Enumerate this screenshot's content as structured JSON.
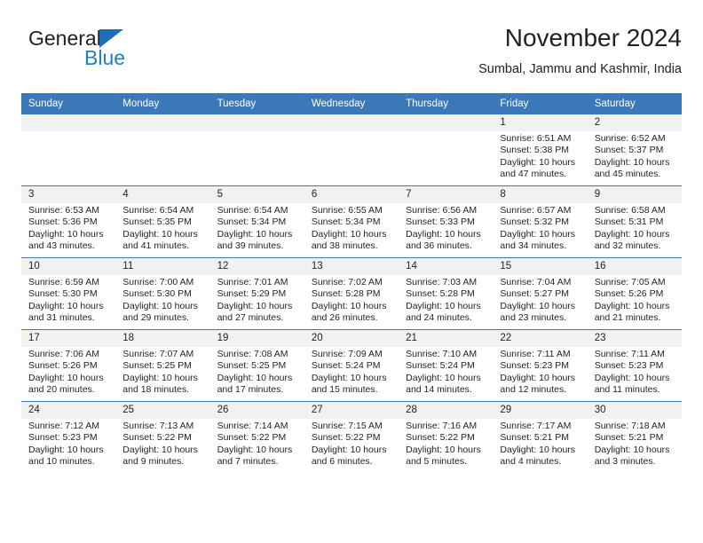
{
  "brand": {
    "word1": "General",
    "word2": "Blue",
    "triangle_color": "#1f6fb5",
    "blue_color": "#1f7fc4"
  },
  "header": {
    "title": "November 2024",
    "subtitle": "Sumbal, Jammu and Kashmir, India"
  },
  "theme": {
    "header_blue": "#3b78b8",
    "daynum_band": "#f1f1f1",
    "text": "#231f20"
  },
  "calendar": {
    "weekdays": [
      "Sunday",
      "Monday",
      "Tuesday",
      "Wednesday",
      "Thursday",
      "Friday",
      "Saturday"
    ],
    "labels": {
      "sunrise": "Sunrise:",
      "sunset": "Sunset:",
      "daylight": "Daylight:"
    },
    "weeks": [
      [
        {
          "day": "",
          "blank": true
        },
        {
          "day": "",
          "blank": true
        },
        {
          "day": "",
          "blank": true
        },
        {
          "day": "",
          "blank": true
        },
        {
          "day": "",
          "blank": true
        },
        {
          "day": "1",
          "sunrise": "Sunrise: 6:51 AM",
          "sunset": "Sunset: 5:38 PM",
          "daylight": "Daylight: 10 hours and 47 minutes."
        },
        {
          "day": "2",
          "sunrise": "Sunrise: 6:52 AM",
          "sunset": "Sunset: 5:37 PM",
          "daylight": "Daylight: 10 hours and 45 minutes."
        }
      ],
      [
        {
          "day": "3",
          "sunrise": "Sunrise: 6:53 AM",
          "sunset": "Sunset: 5:36 PM",
          "daylight": "Daylight: 10 hours and 43 minutes."
        },
        {
          "day": "4",
          "sunrise": "Sunrise: 6:54 AM",
          "sunset": "Sunset: 5:35 PM",
          "daylight": "Daylight: 10 hours and 41 minutes."
        },
        {
          "day": "5",
          "sunrise": "Sunrise: 6:54 AM",
          "sunset": "Sunset: 5:34 PM",
          "daylight": "Daylight: 10 hours and 39 minutes."
        },
        {
          "day": "6",
          "sunrise": "Sunrise: 6:55 AM",
          "sunset": "Sunset: 5:34 PM",
          "daylight": "Daylight: 10 hours and 38 minutes."
        },
        {
          "day": "7",
          "sunrise": "Sunrise: 6:56 AM",
          "sunset": "Sunset: 5:33 PM",
          "daylight": "Daylight: 10 hours and 36 minutes."
        },
        {
          "day": "8",
          "sunrise": "Sunrise: 6:57 AM",
          "sunset": "Sunset: 5:32 PM",
          "daylight": "Daylight: 10 hours and 34 minutes."
        },
        {
          "day": "9",
          "sunrise": "Sunrise: 6:58 AM",
          "sunset": "Sunset: 5:31 PM",
          "daylight": "Daylight: 10 hours and 32 minutes."
        }
      ],
      [
        {
          "day": "10",
          "sunrise": "Sunrise: 6:59 AM",
          "sunset": "Sunset: 5:30 PM",
          "daylight": "Daylight: 10 hours and 31 minutes."
        },
        {
          "day": "11",
          "sunrise": "Sunrise: 7:00 AM",
          "sunset": "Sunset: 5:30 PM",
          "daylight": "Daylight: 10 hours and 29 minutes."
        },
        {
          "day": "12",
          "sunrise": "Sunrise: 7:01 AM",
          "sunset": "Sunset: 5:29 PM",
          "daylight": "Daylight: 10 hours and 27 minutes."
        },
        {
          "day": "13",
          "sunrise": "Sunrise: 7:02 AM",
          "sunset": "Sunset: 5:28 PM",
          "daylight": "Daylight: 10 hours and 26 minutes."
        },
        {
          "day": "14",
          "sunrise": "Sunrise: 7:03 AM",
          "sunset": "Sunset: 5:28 PM",
          "daylight": "Daylight: 10 hours and 24 minutes."
        },
        {
          "day": "15",
          "sunrise": "Sunrise: 7:04 AM",
          "sunset": "Sunset: 5:27 PM",
          "daylight": "Daylight: 10 hours and 23 minutes."
        },
        {
          "day": "16",
          "sunrise": "Sunrise: 7:05 AM",
          "sunset": "Sunset: 5:26 PM",
          "daylight": "Daylight: 10 hours and 21 minutes."
        }
      ],
      [
        {
          "day": "17",
          "sunrise": "Sunrise: 7:06 AM",
          "sunset": "Sunset: 5:26 PM",
          "daylight": "Daylight: 10 hours and 20 minutes."
        },
        {
          "day": "18",
          "sunrise": "Sunrise: 7:07 AM",
          "sunset": "Sunset: 5:25 PM",
          "daylight": "Daylight: 10 hours and 18 minutes."
        },
        {
          "day": "19",
          "sunrise": "Sunrise: 7:08 AM",
          "sunset": "Sunset: 5:25 PM",
          "daylight": "Daylight: 10 hours and 17 minutes."
        },
        {
          "day": "20",
          "sunrise": "Sunrise: 7:09 AM",
          "sunset": "Sunset: 5:24 PM",
          "daylight": "Daylight: 10 hours and 15 minutes."
        },
        {
          "day": "21",
          "sunrise": "Sunrise: 7:10 AM",
          "sunset": "Sunset: 5:24 PM",
          "daylight": "Daylight: 10 hours and 14 minutes."
        },
        {
          "day": "22",
          "sunrise": "Sunrise: 7:11 AM",
          "sunset": "Sunset: 5:23 PM",
          "daylight": "Daylight: 10 hours and 12 minutes."
        },
        {
          "day": "23",
          "sunrise": "Sunrise: 7:11 AM",
          "sunset": "Sunset: 5:23 PM",
          "daylight": "Daylight: 10 hours and 11 minutes."
        }
      ],
      [
        {
          "day": "24",
          "sunrise": "Sunrise: 7:12 AM",
          "sunset": "Sunset: 5:23 PM",
          "daylight": "Daylight: 10 hours and 10 minutes."
        },
        {
          "day": "25",
          "sunrise": "Sunrise: 7:13 AM",
          "sunset": "Sunset: 5:22 PM",
          "daylight": "Daylight: 10 hours and 9 minutes."
        },
        {
          "day": "26",
          "sunrise": "Sunrise: 7:14 AM",
          "sunset": "Sunset: 5:22 PM",
          "daylight": "Daylight: 10 hours and 7 minutes."
        },
        {
          "day": "27",
          "sunrise": "Sunrise: 7:15 AM",
          "sunset": "Sunset: 5:22 PM",
          "daylight": "Daylight: 10 hours and 6 minutes."
        },
        {
          "day": "28",
          "sunrise": "Sunrise: 7:16 AM",
          "sunset": "Sunset: 5:22 PM",
          "daylight": "Daylight: 10 hours and 5 minutes."
        },
        {
          "day": "29",
          "sunrise": "Sunrise: 7:17 AM",
          "sunset": "Sunset: 5:21 PM",
          "daylight": "Daylight: 10 hours and 4 minutes."
        },
        {
          "day": "30",
          "sunrise": "Sunrise: 7:18 AM",
          "sunset": "Sunset: 5:21 PM",
          "daylight": "Daylight: 10 hours and 3 minutes."
        }
      ]
    ]
  }
}
